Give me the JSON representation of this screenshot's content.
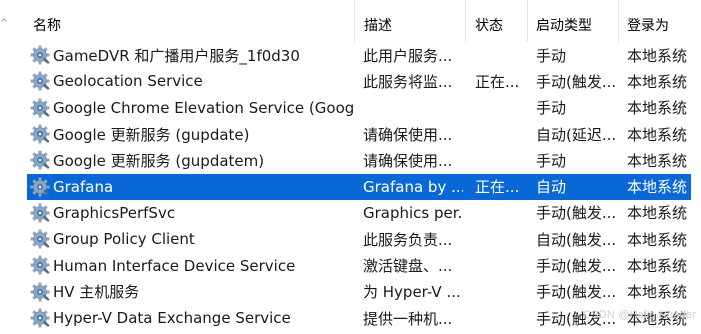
{
  "columns": {
    "name": "名称",
    "description": "描述",
    "status": "状态",
    "startup_type": "启动类型",
    "logon_as": "登录为"
  },
  "sort_indicator": "^",
  "services": [
    {
      "name": "GameDVR 和广播用户服务_1f0d30",
      "description": "此用户服务...",
      "status": "",
      "startup_type": "手动",
      "logon_as": "本地系统",
      "selected": false
    },
    {
      "name": "Geolocation Service",
      "description": "此服务将监...",
      "status": "正在...",
      "startup_type": "手动(触发...",
      "logon_as": "本地系统",
      "selected": false
    },
    {
      "name": "Google Chrome Elevation Service (Google...",
      "description": "",
      "status": "",
      "startup_type": "手动",
      "logon_as": "本地系统",
      "selected": false
    },
    {
      "name": "Google 更新服务 (gupdate)",
      "description": "请确保使用...",
      "status": "",
      "startup_type": "自动(延迟...",
      "logon_as": "本地系统",
      "selected": false
    },
    {
      "name": "Google 更新服务 (gupdatem)",
      "description": "请确保使用...",
      "status": "",
      "startup_type": "手动",
      "logon_as": "本地系统",
      "selected": false
    },
    {
      "name": "Grafana",
      "description": "Grafana by ...",
      "status": "正在...",
      "startup_type": "自动",
      "logon_as": "本地系统",
      "selected": true
    },
    {
      "name": "GraphicsPerfSvc",
      "description": "Graphics per...",
      "status": "",
      "startup_type": "手动(触发...",
      "logon_as": "本地系统",
      "selected": false
    },
    {
      "name": "Group Policy Client",
      "description": "此服务负责...",
      "status": "",
      "startup_type": "自动(触发...",
      "logon_as": "本地系统",
      "selected": false
    },
    {
      "name": "Human Interface Device Service",
      "description": "激活键盘、...",
      "status": "",
      "startup_type": "手动(触发...",
      "logon_as": "本地系统",
      "selected": false
    },
    {
      "name": "HV 主机服务",
      "description": "为 Hyper-V ...",
      "status": "",
      "startup_type": "手动(触发...",
      "logon_as": "本地系统",
      "selected": false
    },
    {
      "name": "Hyper-V Data Exchange Service",
      "description": "提供一种机...",
      "status": "",
      "startup_type": "手动(触发...",
      "logon_as": "本地系统",
      "selected": false
    }
  ],
  "watermark": "CSDN @Hello.Reader",
  "colors": {
    "selection": "#0a68d6",
    "gear_body": "#8fa6bd",
    "gear_center": "#3a78c2"
  },
  "icon_names": {
    "service": "service-gear-icon"
  }
}
